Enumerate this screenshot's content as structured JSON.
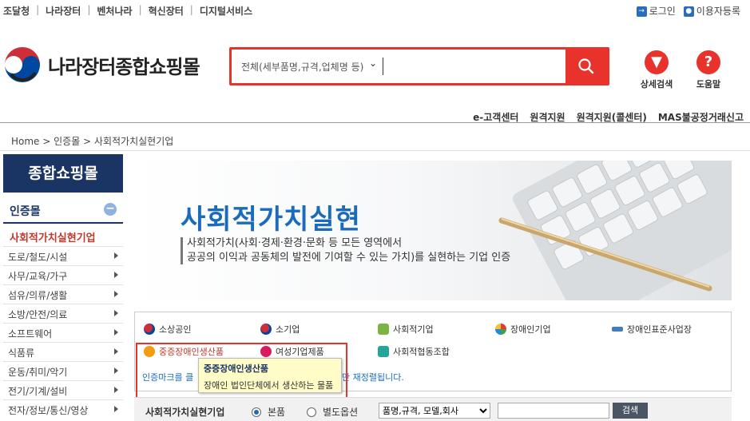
{
  "topbar": {
    "links": [
      "조달청",
      "나라장터",
      "벤처나라",
      "혁신장터",
      "디지털서비스"
    ],
    "login": "로그인",
    "register": "이용자등록"
  },
  "header": {
    "brand": "나라장터종합쇼핑몰",
    "search_placeholder": "전체(세부품명,규격,업체명 등)",
    "detail_search": "상세검색",
    "help": "도움말"
  },
  "subnav": [
    "e-고객센터",
    "원격지원",
    "원격지원(콜센터)",
    "MAS불공정거래신고"
  ],
  "breadcrumb": "Home > 인증몰 > 사회적가치실현기업",
  "sidebar": {
    "title": "종합쇼핑몰",
    "category": "인증몰",
    "active": "사회적가치실현기업",
    "items": [
      "도로/철도/시설",
      "사무/교육/가구",
      "섬유/의류/생활",
      "소방/안전/의료",
      "소프트웨어",
      "식품류",
      "운동/취미/악기",
      "전기/기계/설비",
      "전자/정보/통신/영상"
    ]
  },
  "banner": {
    "title": "사회적가치실현",
    "desc1": "사회적가치(사회·경제·환경·문화 등 모든 영역에서",
    "desc2": "공공의 이익과 공동체의 발전에 기여할 수 있는 가치)를 실현하는 기업 인증"
  },
  "certs": {
    "row1": [
      "소상공인",
      "소기업",
      "사회적기업",
      "장애인기업",
      "장애인표준사업장"
    ],
    "row2": [
      "중증장애인생산품",
      "여성기업제품",
      "사회적협동조합"
    ]
  },
  "notice": {
    "left": "인증마크를 클",
    "right": "만 재정렬됩니다."
  },
  "tooltip": {
    "title": "중증장애인생산품",
    "body": "장애인 법인단체에서 생산하는 물품"
  },
  "filter": {
    "label": "사회적가치실현기업",
    "opt1": "본품",
    "opt2": "별도옵션",
    "select": "품명,규격, 모델,회사",
    "button": "검색"
  },
  "colors": {
    "accent": "#e8322b",
    "navy": "#1a3463",
    "blue": "#1b6bbd"
  }
}
